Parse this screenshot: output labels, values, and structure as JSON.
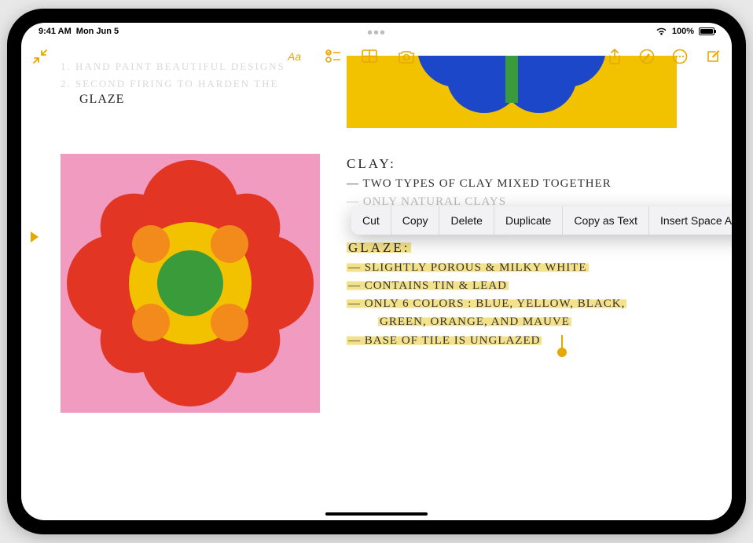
{
  "status": {
    "time": "9:41 AM",
    "date": "Mon Jun 5",
    "battery_percent": "100%"
  },
  "toolbar": {
    "icons": {
      "collapse": "collapse-arrows-icon",
      "more": "more-icon",
      "format": "format-text-icon",
      "checklist": "checklist-icon",
      "table": "table-icon",
      "camera": "camera-icon",
      "share": "share-icon",
      "pencil": "smart-annotation-icon",
      "ellipsis": "ellipsis-circle-icon",
      "compose": "compose-icon"
    }
  },
  "left_notes": {
    "faded_line1": "1. HAND PAINT BEAUTIFUL DESIGNS",
    "faded_line2": "2. SECOND FIRING TO HARDEN THE",
    "line3": "GLAZE"
  },
  "right_notes": {
    "clay_heading": "CLAY:",
    "clay_items": [
      "— TWO TYPES OF CLAY MIXED TOGETHER",
      "— ONLY NATURAL CLAYS"
    ],
    "glaze_heading": "GLAZE:",
    "glaze_items": [
      "— SLIGHTLY POROUS & MILKY WHITE",
      "— CONTAINS TIN & LEAD",
      "— ONLY 6 COLORS : BLUE, YELLOW, BLACK,",
      "GREEN, ORANGE, AND MAUVE",
      "— BASE OF TILE IS UNGLAZED"
    ]
  },
  "context_menu": {
    "items": [
      "Cut",
      "Copy",
      "Delete",
      "Duplicate",
      "Copy as Text",
      "Insert Space Above"
    ]
  },
  "colors": {
    "accent": "#e6a800",
    "highlight": "#f4e28a",
    "tile_bg": "#f29bc1",
    "flower_red": "#e33524",
    "flower_orange": "#f28a1c",
    "flower_yellow": "#f2c200",
    "flower_green": "#3a9b3a",
    "top_tile_bg": "#f2c200",
    "top_flower_blue": "#1d47c9",
    "top_flower_green": "#3a9b3a"
  }
}
